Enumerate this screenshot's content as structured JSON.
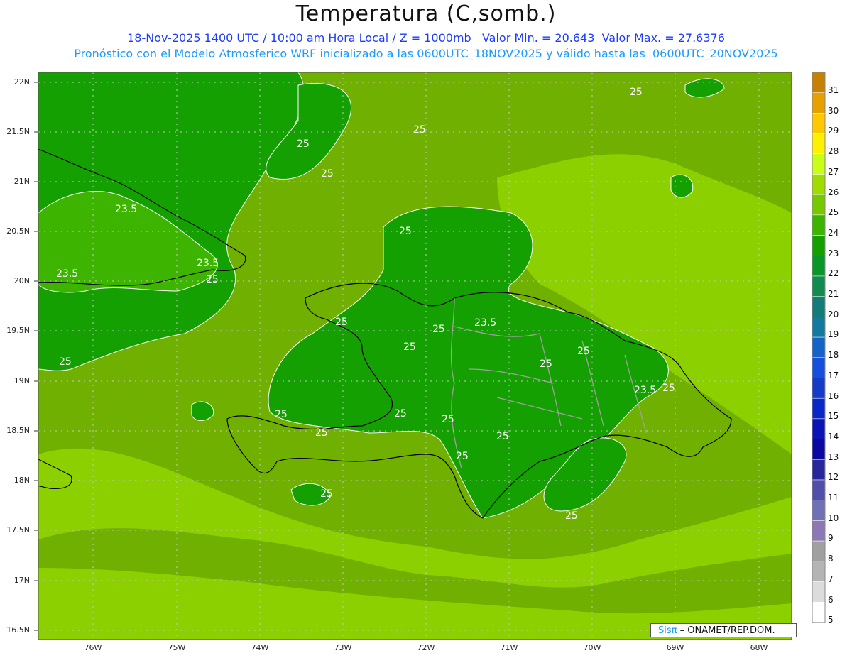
{
  "header": {
    "title": "Temperatura (C,somb.)",
    "line1": "18-Nov-2025 1400 UTC / 10:00 am Hora Local / Z = 1000mb   Valor Min. = 20.643  Valor Max. = 27.6376",
    "line2": "Pronóstico con el Modelo Atmosferico WRF inicializado a las 0600UTC_18NOV2025 y válido hasta las  0600UTC_20NOV2025"
  },
  "axes": {
    "lat_labels": [
      "22N",
      "21.5N",
      "21N",
      "20.5N",
      "20N",
      "19.5N",
      "19N",
      "18.5N",
      "18N",
      "17.5N",
      "17N",
      "16.5N"
    ],
    "lon_labels": [
      "76W",
      "75W",
      "74W",
      "73W",
      "72W",
      "71W",
      "70W",
      "69W",
      "68W"
    ]
  },
  "colorbar": {
    "labels": [
      "31",
      "30",
      "29",
      "28",
      "27",
      "26",
      "25",
      "24",
      "23",
      "22",
      "21",
      "20",
      "19",
      "18",
      "17",
      "16",
      "15",
      "14",
      "13",
      "12",
      "11",
      "10",
      "9",
      "8",
      "7",
      "6",
      "5"
    ],
    "colors": [
      "#c88000",
      "#e6a000",
      "#ffc800",
      "#fff000",
      "#c8ff14",
      "#a0dc00",
      "#78c800",
      "#3cb400",
      "#14a000",
      "#0a9628",
      "#108c50",
      "#147c78",
      "#1478a0",
      "#1464c8",
      "#1450dc",
      "#143cc8",
      "#0a28c8",
      "#0a14b4",
      "#0a0aa0",
      "#28289b",
      "#5050aa",
      "#7070b4",
      "#8c78b4",
      "#a0a0a0",
      "#b4b4b4",
      "#dcdcdc",
      "#ffffff"
    ]
  },
  "contour_labels": [
    "25",
    "23.5"
  ],
  "colors": {
    "sea_base": "#6fb000",
    "land_dark": "#14a000",
    "land_mid": "#3cb400",
    "light": "#8cd000"
  },
  "credit": {
    "sis": "Sisπ",
    "text": " – ONAMET/REP.DOM."
  }
}
